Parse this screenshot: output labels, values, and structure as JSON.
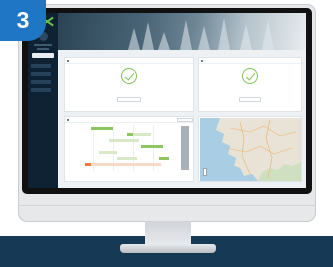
{
  "step": {
    "number": "3"
  },
  "app": {
    "breadcrumb": "",
    "page_title": "",
    "sidebar": {
      "primary_button": "",
      "nav": [
        "",
        "",
        "",
        ""
      ]
    }
  },
  "cards": {
    "left": {
      "title": "",
      "message": "",
      "button": ""
    },
    "right": {
      "title": "",
      "message": "",
      "button": ""
    }
  },
  "gantt": {
    "title": "",
    "zoom_label": "",
    "rows": [
      "",
      "",
      "",
      "",
      "",
      "",
      ""
    ],
    "ticks": [
      "",
      "",
      "",
      "",
      ""
    ]
  },
  "colors": {
    "badge": "#1f76c4",
    "sidebar": "#0f2233",
    "accent_green": "#7fc45a",
    "bar_orange": "#f07b3f",
    "floor": "#163a56"
  }
}
